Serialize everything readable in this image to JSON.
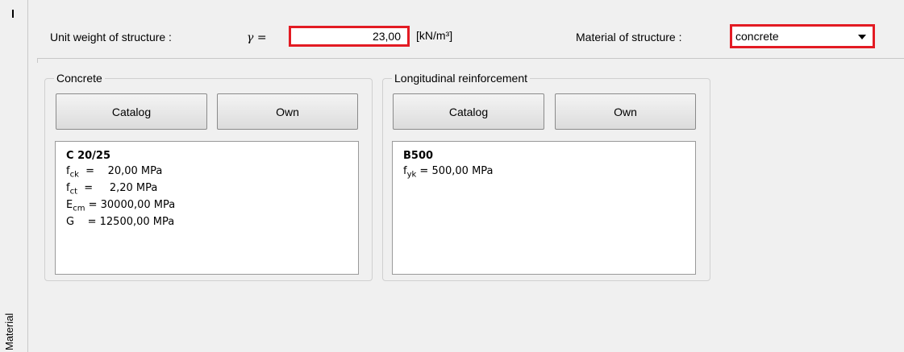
{
  "side_tab": {
    "label": "Material"
  },
  "header": {
    "unit_weight_label": "Unit weight of structure :",
    "gamma_symbol": "γ =",
    "unit_weight_value": "23,00",
    "unit_weight_unit": "[kN/m³]",
    "material_label": "Material of structure :",
    "material_value": "concrete"
  },
  "concrete": {
    "title": "Concrete",
    "catalog_label": "Catalog",
    "own_label": "Own",
    "grade": "C 20/25",
    "rows": [
      {
        "sym": "f",
        "sub": "ck",
        "eq": "  =",
        "val": "    20,00 MPa"
      },
      {
        "sym": "f",
        "sub": "ct",
        "eq": "  =",
        "val": "     2,20 MPa"
      },
      {
        "sym": "E",
        "sub": "cm",
        "eq": " =",
        "val": " 30000,00 MPa"
      },
      {
        "sym": "G",
        "sub": "",
        "eq": "    =",
        "val": " 12500,00 MPa"
      }
    ]
  },
  "reinforcement": {
    "title": "Longitudinal reinforcement",
    "catalog_label": "Catalog",
    "own_label": "Own",
    "grade": "B500",
    "rows": [
      {
        "sym": "f",
        "sub": "yk",
        "eq": " =",
        "val": " 500,00 MPa"
      }
    ]
  },
  "colors": {
    "highlight": "#e31b23",
    "background": "#f0f0f0"
  }
}
